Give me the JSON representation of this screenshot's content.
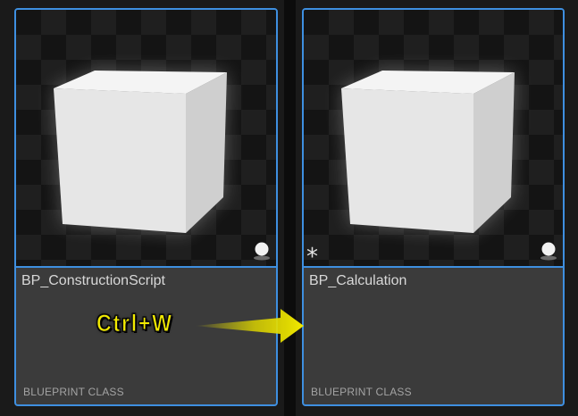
{
  "assets": [
    {
      "name": "BP_ConstructionScript",
      "type_label": "BLUEPRINT CLASS",
      "modified": false
    },
    {
      "name": "BP_Calculation",
      "type_label": "BLUEPRINT CLASS",
      "modified": true,
      "modified_marker": "*"
    }
  ],
  "annotation": {
    "shortcut": "Ctrl+W",
    "color": "#f2ea00"
  },
  "colors": {
    "selection_border": "#3e8fe0",
    "tile_bg": "#3b3b3b",
    "thumb_bg": "#141414"
  },
  "icons": {
    "cube_preview": "cube-preview-icon",
    "asset_type_badge": "sphere-badge-icon",
    "unsaved_marker": "asterisk-icon",
    "arrow": "arrow-right-icon"
  }
}
